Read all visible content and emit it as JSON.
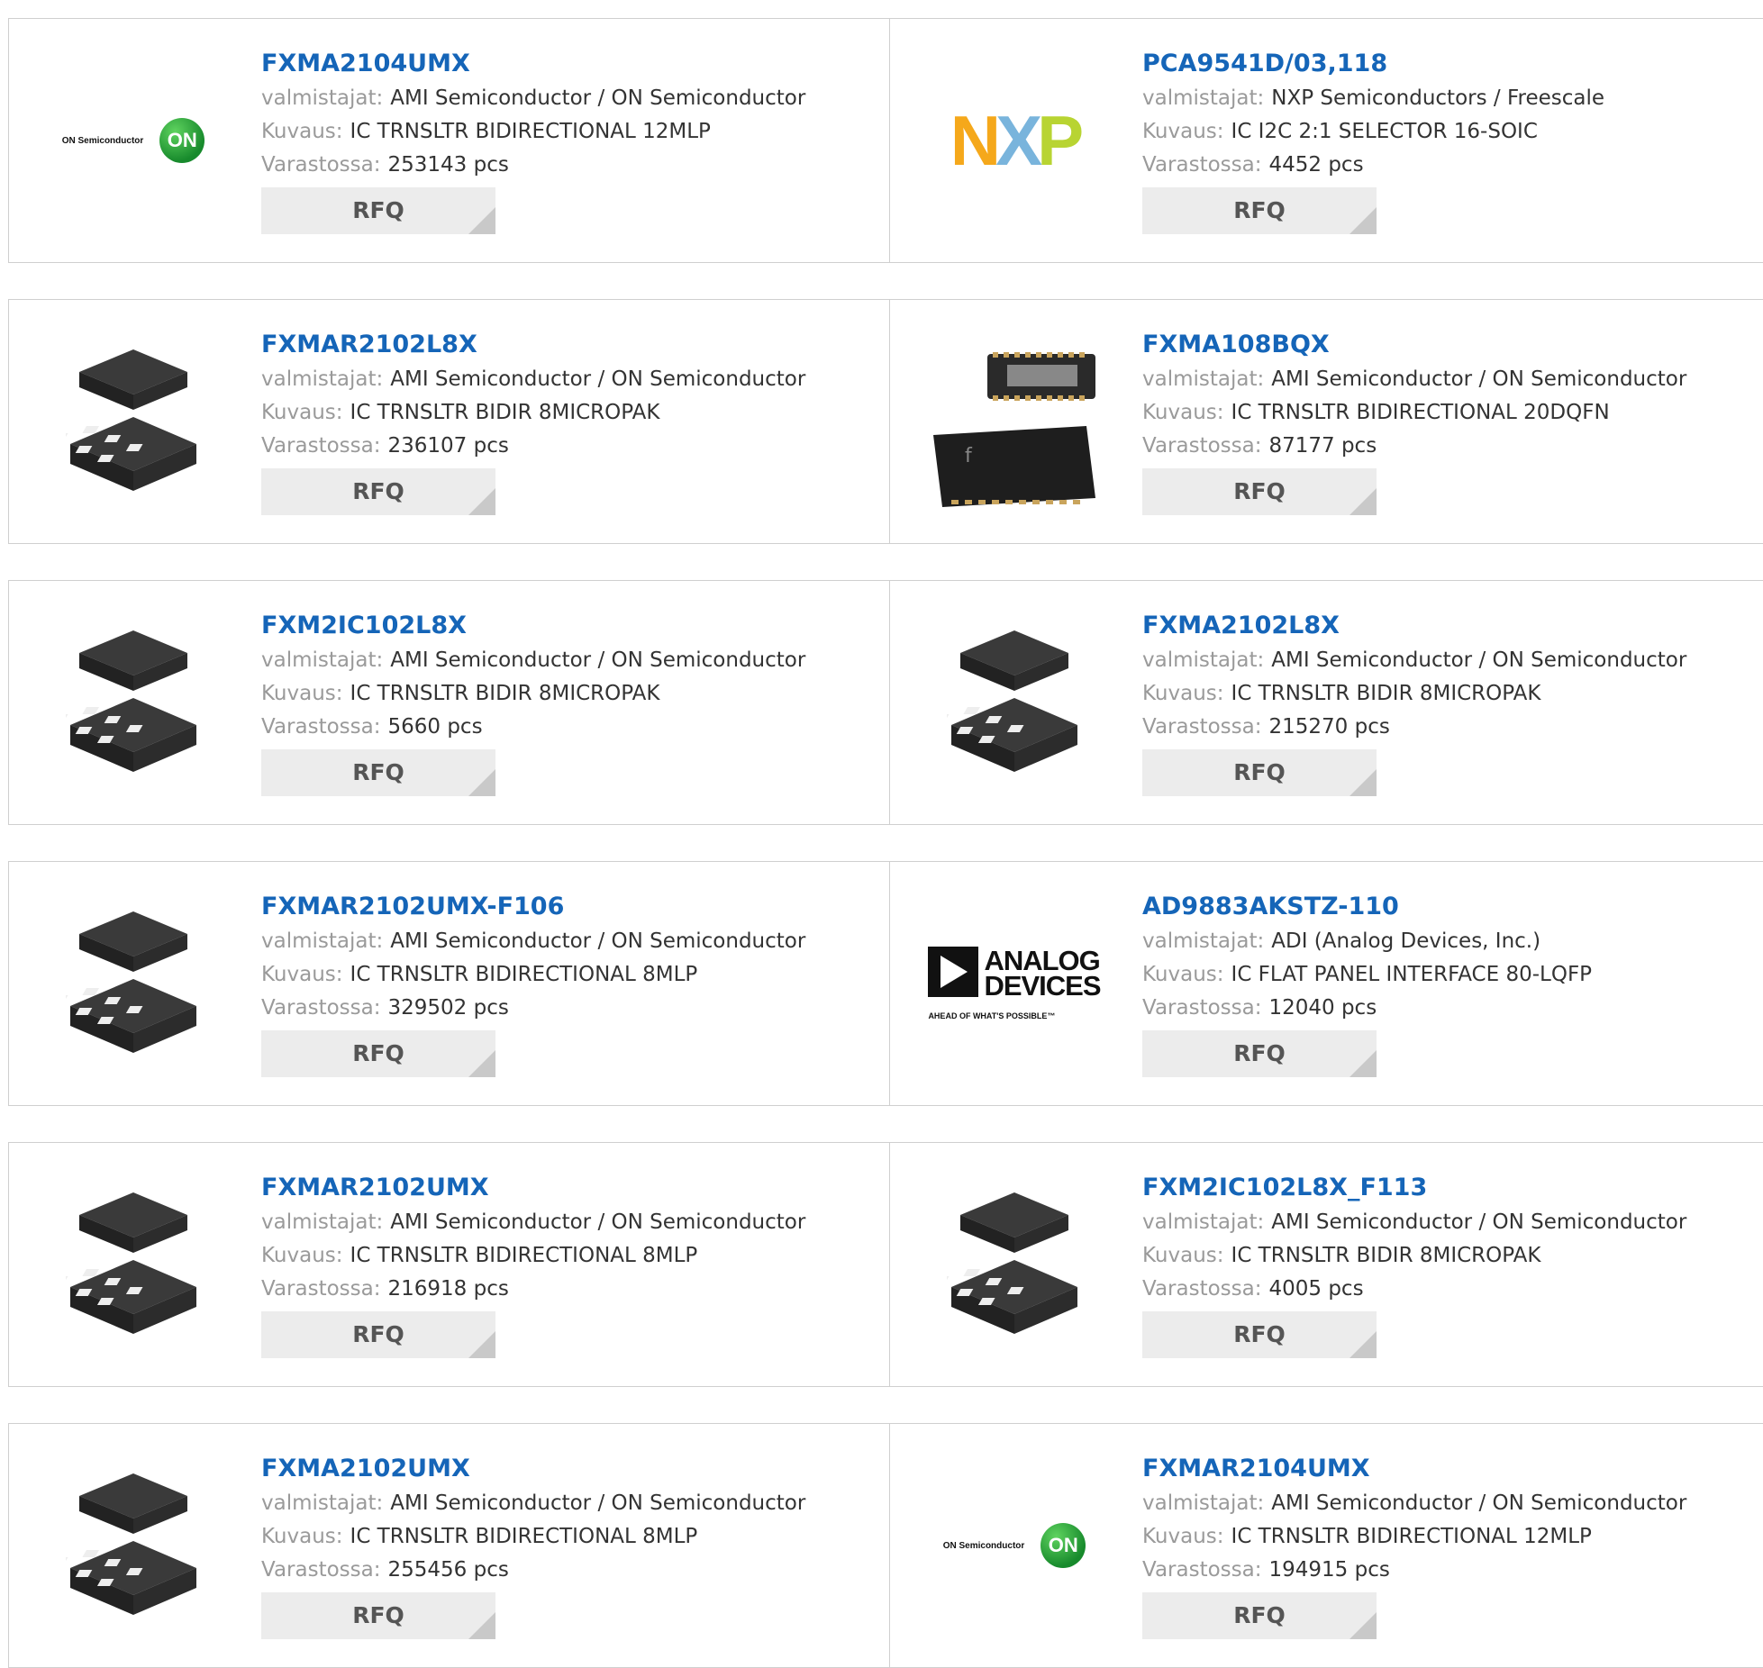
{
  "labels": {
    "manufacturer": "valmistajat:",
    "description": "Kuvaus:",
    "stock": "Varastossa:",
    "rfq": "RFQ"
  },
  "products": [
    {
      "part": "FXMA2104UMX",
      "manufacturer": "AMI Semiconductor / ON Semiconductor",
      "description": "IC TRNSLTR BIDIRECTIONAL 12MLP",
      "stock": "253143 pcs",
      "image": "on-semiconductor-logo",
      "logo_text": "ON Semiconductor",
      "logo_mark": "ON"
    },
    {
      "part": "PCA9541D/03,118",
      "manufacturer": "NXP Semiconductors / Freescale",
      "description": "IC I2C 2:1 SELECTOR 16-SOIC",
      "stock": "4452 pcs",
      "image": "nxp-logo",
      "logo_letters": [
        "N",
        "X",
        "P"
      ],
      "logo_colors": [
        "#f5a81b",
        "#79b4dc",
        "#b8d432"
      ]
    },
    {
      "part": "FXMAR2102L8X",
      "manufacturer": "AMI Semiconductor / ON Semiconductor",
      "description": "IC TRNSLTR BIDIR 8MICROPAK",
      "stock": "236107 pcs",
      "image": "micropak-chip"
    },
    {
      "part": "FXMA108BQX",
      "manufacturer": "AMI Semiconductor / ON Semiconductor",
      "description": "IC TRNSLTR BIDIRECTIONAL 20DQFN",
      "stock": "87177 pcs",
      "image": "dqfn-chip"
    },
    {
      "part": "FXM2IC102L8X",
      "manufacturer": "AMI Semiconductor / ON Semiconductor",
      "description": "IC TRNSLTR BIDIR 8MICROPAK",
      "stock": "5660 pcs",
      "image": "micropak-chip"
    },
    {
      "part": "FXMA2102L8X",
      "manufacturer": "AMI Semiconductor / ON Semiconductor",
      "description": "IC TRNSLTR BIDIR 8MICROPAK",
      "stock": "215270 pcs",
      "image": "micropak-chip"
    },
    {
      "part": "FXMAR2102UMX-F106",
      "manufacturer": "AMI Semiconductor / ON Semiconductor",
      "description": "IC TRNSLTR BIDIRECTIONAL 8MLP",
      "stock": "329502 pcs",
      "image": "micropak-chip"
    },
    {
      "part": "AD9883AKSTZ-110",
      "manufacturer": "ADI (Analog Devices, Inc.)",
      "description": "IC FLAT PANEL INTERFACE 80-LQFP",
      "stock": "12040 pcs",
      "image": "analog-devices-logo",
      "logo_words": [
        "ANALOG",
        "DEVICES"
      ],
      "logo_tagline": "AHEAD OF WHAT'S POSSIBLE™"
    },
    {
      "part": "FXMAR2102UMX",
      "manufacturer": "AMI Semiconductor / ON Semiconductor",
      "description": "IC TRNSLTR BIDIRECTIONAL 8MLP",
      "stock": "216918 pcs",
      "image": "micropak-chip"
    },
    {
      "part": "FXM2IC102L8X_F113",
      "manufacturer": "AMI Semiconductor / ON Semiconductor",
      "description": "IC TRNSLTR BIDIR 8MICROPAK",
      "stock": "4005 pcs",
      "image": "micropak-chip"
    },
    {
      "part": "FXMA2102UMX",
      "manufacturer": "AMI Semiconductor / ON Semiconductor",
      "description": "IC TRNSLTR BIDIRECTIONAL 8MLP",
      "stock": "255456 pcs",
      "image": "micropak-chip"
    },
    {
      "part": "FXMAR2104UMX",
      "manufacturer": "AMI Semiconductor / ON Semiconductor",
      "description": "IC TRNSLTR BIDIRECTIONAL 12MLP",
      "stock": "194915 pcs",
      "image": "on-semiconductor-logo",
      "logo_text": "ON Semiconductor",
      "logo_mark": "ON"
    }
  ]
}
